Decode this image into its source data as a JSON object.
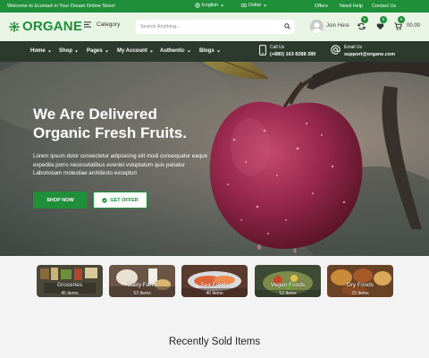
{
  "topbar": {
    "welcome": "Welcome to Ecomart in Your Dream Online Store!",
    "language": "English",
    "currency": "Dollar",
    "links": [
      "Offers",
      "Need Help",
      "Contact Us"
    ]
  },
  "header": {
    "logo": "ORGANE",
    "category_label": "Category",
    "search_placeholder": "Search Anything...",
    "join": "Join Here",
    "compare_count": "0",
    "wishlist_count": "0",
    "cart_count": "0",
    "cart_total": "00.00"
  },
  "nav": {
    "items": [
      "Home",
      "Shop",
      "Pages",
      "My Account",
      "Authentic",
      "Blogs"
    ],
    "call_label": "Call Us",
    "call_value": "(+880) 163 8288 389",
    "email_label": "Email Us",
    "email_value": "support@organe.com"
  },
  "hero": {
    "title_line1": "We Are Delivered",
    "title_line2": "Organic Fresh Fruits.",
    "description": "Lorem ipsum dolor consectetur adipisicing elit modi consequatur eaque expedita porro necessitatibus eveniet voluptatum quis pariatur Laboriosam molestiae architecto excepturi",
    "shop_now": "SHOP NOW",
    "get_offer": "GET OFFER"
  },
  "categories": [
    {
      "name": "Groceries",
      "count": "45 Items"
    },
    {
      "name": "Dairy Farm",
      "count": "53 Items"
    },
    {
      "name": "Sea Foods",
      "count": "40 Items"
    },
    {
      "name": "Vegan Foods",
      "count": "53 Items"
    },
    {
      "name": "Dry Foods",
      "count": "23 Items"
    }
  ],
  "section_title": "Recently Sold Items",
  "colors": {
    "brand": "#1f8f3a",
    "nav": "#2b3a2c",
    "header": "#e8f4e4"
  }
}
